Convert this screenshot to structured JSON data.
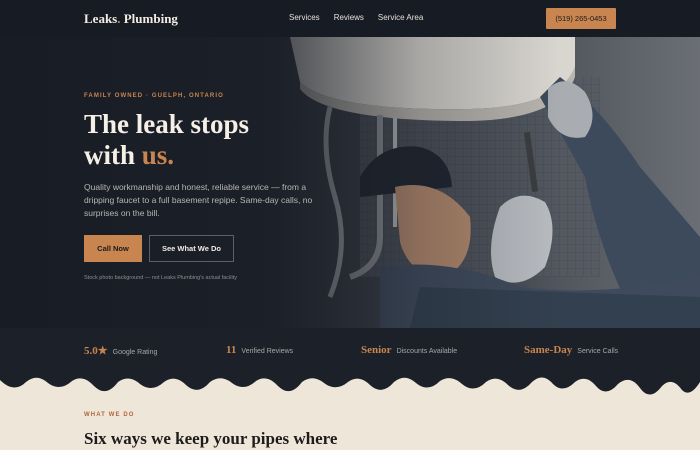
{
  "nav": {
    "logo_main": "Leaks",
    "logo_dot": ".",
    "logo_rest": " Plumbing",
    "links": [
      "Services",
      "Reviews",
      "Service Area"
    ],
    "phone": "(519) 265-0453"
  },
  "hero": {
    "eyebrow": "FAMILY OWNED · GUELPH, ONTARIO",
    "title_line1": "The leak stops",
    "title_line2_start": "with ",
    "title_line2_accent": "us.",
    "description": "Quality workmanship and honest, reliable service — from a dripping faucet to a full basement repipe. Same-day calls, no surprises on the bill.",
    "primary_cta": "Call Now",
    "secondary_cta": "See What We Do",
    "photo_note": "Stock photo background — not Leaks Plumbing's actual facility"
  },
  "stats": [
    {
      "value": "5.0★",
      "label": "Google Rating"
    },
    {
      "value": "11",
      "label": "Verified Reviews"
    },
    {
      "value": "Senior",
      "label": "Discounts Available"
    },
    {
      "value": "Same-Day",
      "label": "Service Calls"
    }
  ],
  "services": {
    "eyebrow": "WHAT WE DO",
    "title": "Six ways we keep your pipes where"
  },
  "colors": {
    "accent": "#c98550",
    "dark": "#171b23",
    "cream": "#efe6da"
  }
}
